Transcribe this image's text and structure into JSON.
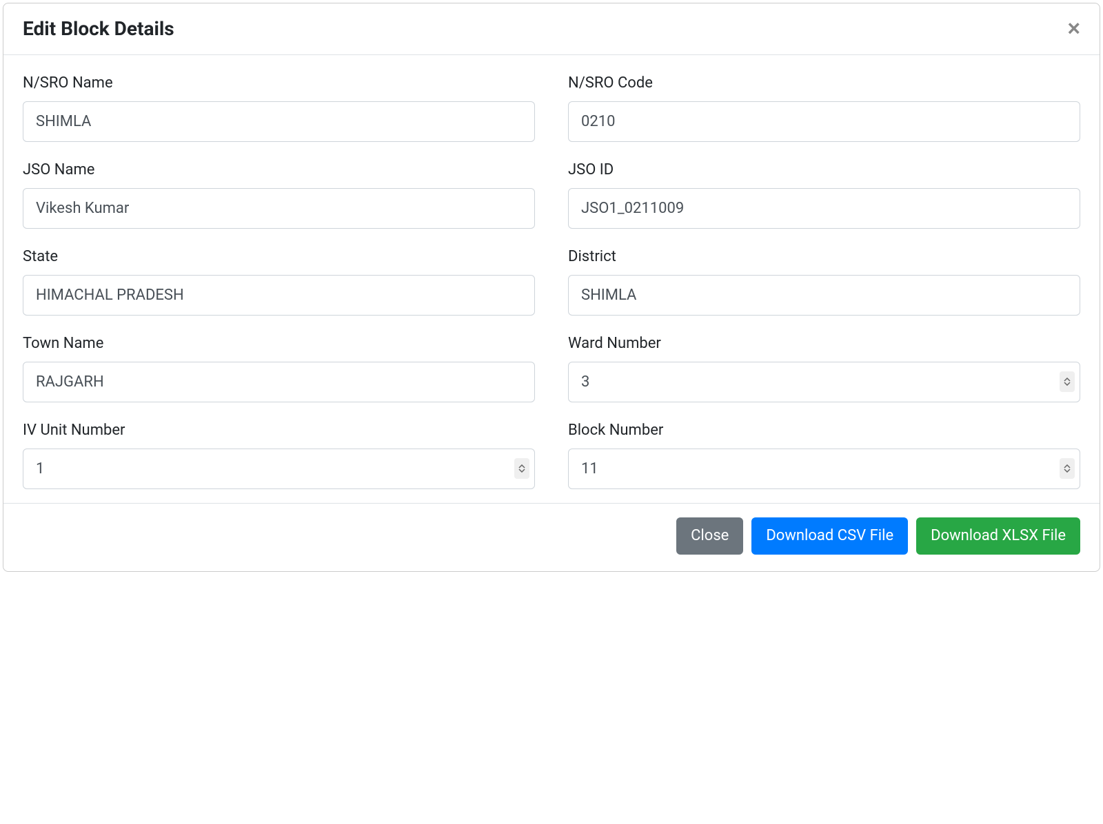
{
  "modal": {
    "title": "Edit Block Details"
  },
  "form": {
    "nsro_name": {
      "label": "N/SRO Name",
      "value": "SHIMLA"
    },
    "nsro_code": {
      "label": "N/SRO Code",
      "value": "0210"
    },
    "jso_name": {
      "label": "JSO Name",
      "value": "Vikesh Kumar"
    },
    "jso_id": {
      "label": "JSO ID",
      "value": "JSO1_0211009"
    },
    "state": {
      "label": "State",
      "value": "HIMACHAL PRADESH"
    },
    "district": {
      "label": "District",
      "value": "SHIMLA"
    },
    "town_name": {
      "label": "Town Name",
      "value": "RAJGARH"
    },
    "ward_number": {
      "label": "Ward Number",
      "value": "3"
    },
    "iv_unit_number": {
      "label": "IV Unit Number",
      "value": "1"
    },
    "block_number": {
      "label": "Block Number",
      "value": "11"
    }
  },
  "footer": {
    "close": "Close",
    "download_csv": "Download CSV File",
    "download_xlsx": "Download XLSX File"
  }
}
